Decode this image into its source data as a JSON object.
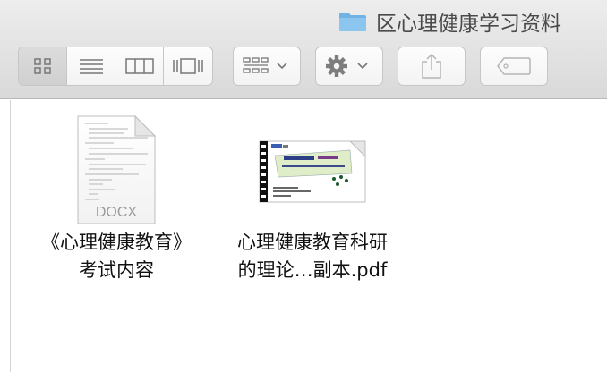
{
  "window": {
    "title": "区心理健康学习资料"
  },
  "toolbar": {
    "view_modes": [
      "icon-view",
      "list-view",
      "column-view",
      "cover-flow-view"
    ],
    "active_view": 0
  },
  "files": [
    {
      "type": "docx",
      "badge": "DOCX",
      "label_line1": "《心理健康教育》",
      "label_line2": "考试内容"
    },
    {
      "type": "pdf",
      "label_line1": "心理健康教育科研",
      "label_line2": "的理论…副本.pdf"
    }
  ],
  "colors": {
    "folder": "#7ab9e6",
    "toolbar_icon": "#888888"
  }
}
